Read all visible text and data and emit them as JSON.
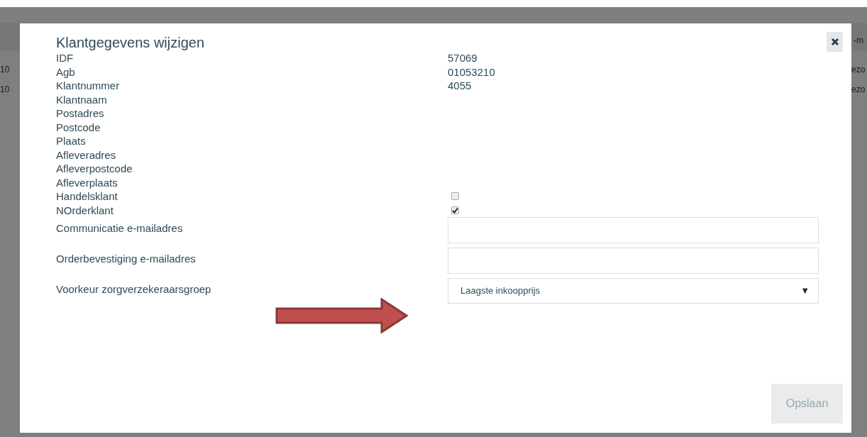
{
  "background": {
    "header_fragment": "-m",
    "left_fragments": [
      "10",
      "10"
    ],
    "right_fragments": [
      "ezo",
      "ezo"
    ]
  },
  "dialog": {
    "title": "Klantgegevens wijzigen",
    "fields": [
      {
        "kind": "text",
        "label": "IDF",
        "value": "57069"
      },
      {
        "kind": "text",
        "label": "Agb",
        "value": "01053210"
      },
      {
        "kind": "text",
        "label": "Klantnummer",
        "value": "4055"
      },
      {
        "kind": "text",
        "label": "Klantnaam"
      },
      {
        "kind": "text",
        "label": "Postadres"
      },
      {
        "kind": "text",
        "label": "Postcode"
      },
      {
        "kind": "text",
        "label": "Plaats"
      },
      {
        "kind": "text",
        "label": "Afleveradres"
      },
      {
        "kind": "text",
        "label": "Afleverpostcode"
      },
      {
        "kind": "text",
        "label": "Afleverplaats"
      },
      {
        "kind": "checkbox",
        "label": "Handelsklant",
        "checked": false
      },
      {
        "kind": "checkbox",
        "label": "NOrderklant",
        "checked": true
      },
      {
        "kind": "input",
        "label": "Communicatie e-mailadres"
      },
      {
        "kind": "input",
        "label": "Orderbevestiging e-mailadres"
      },
      {
        "kind": "select",
        "label": "Voorkeur zorgverzekeraarsgroep",
        "value": "Laagste inkoopprijs",
        "caret": "▼"
      }
    ],
    "save_button": {
      "label": "Opslaan",
      "disabled": true
    }
  },
  "annotation": {
    "kind": "arrow"
  }
}
